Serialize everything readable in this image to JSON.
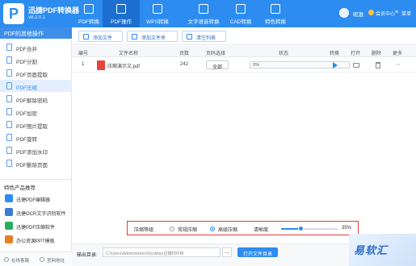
{
  "app": {
    "name": "迅捷PDF转换器",
    "version": "v8.2.0.1"
  },
  "nav": [
    {
      "label": "PDF转换",
      "active": false
    },
    {
      "label": "PDF操作",
      "active": true
    },
    {
      "label": "WPS转换",
      "active": false
    },
    {
      "label": "文字语音转换",
      "active": false
    },
    {
      "label": "CAD转换",
      "active": false
    },
    {
      "label": "特色转换",
      "active": false
    }
  ],
  "user": {
    "name": "昵激",
    "vip_label": "会员中心",
    "menu_label": "菜单"
  },
  "sidebar": {
    "header": "PDF的其他操作",
    "items": [
      {
        "label": "PDF合并",
        "active": false
      },
      {
        "label": "PDF分割",
        "active": false
      },
      {
        "label": "PDF页面提取",
        "active": false
      },
      {
        "label": "PDF压缩",
        "active": true
      },
      {
        "label": "PDF解除密码",
        "active": false
      },
      {
        "label": "PDF加密",
        "active": false
      },
      {
        "label": "PDF图片提取",
        "active": false
      },
      {
        "label": "PDF旋转",
        "active": false
      },
      {
        "label": "PDF添加水印",
        "active": false
      },
      {
        "label": "PDF删除页面",
        "active": false
      }
    ],
    "promo_title": "特色产品推荐",
    "promos": [
      {
        "label": "迅捷PDF编辑器",
        "color": "#2d8cf0"
      },
      {
        "label": "迅捷OCR文字识别软件",
        "color": "#3a7bd5"
      },
      {
        "label": "迅捷PDF压缩软件",
        "color": "#27ae60"
      },
      {
        "label": "办公资源PPT模板",
        "color": "#e67e22"
      }
    ],
    "footer": {
      "online": "在线客服",
      "website": "官网地址"
    }
  },
  "toolbar": {
    "add_file": "添加文件",
    "add_folder": "添加文件夹",
    "clear_list": "清空列表"
  },
  "table": {
    "headers": {
      "index": "编号",
      "name": "文件名称",
      "pages": "页数",
      "page_select": "页码选择",
      "status": "状态",
      "convert": "转换",
      "open": "打开",
      "delete": "删除",
      "more": "更多"
    },
    "rows": [
      {
        "index": "1",
        "name": "压缩演示文.pdf",
        "pages": "242",
        "page_select": "全部",
        "progress_text": "0%",
        "progress": 0
      }
    ]
  },
  "compression": {
    "level_label": "压缩等级:",
    "option_normal": "常规压缩",
    "option_high": "高级压缩",
    "selected": "high",
    "clarity_label": "清晰度:",
    "clarity_value": 35,
    "clarity_text": "35%"
  },
  "output": {
    "label": "输出目录:",
    "path": "C:\\Users\\Administrator\\Desktop\\迅捷PDF转",
    "browse_label": "...",
    "open_folder": "打开文件目录"
  },
  "watermark": {
    "text": "易软汇"
  },
  "colors": {
    "primary": "#2d8cf0",
    "highlight_border": "#e33b3b",
    "pdf_red": "#e8453c"
  }
}
